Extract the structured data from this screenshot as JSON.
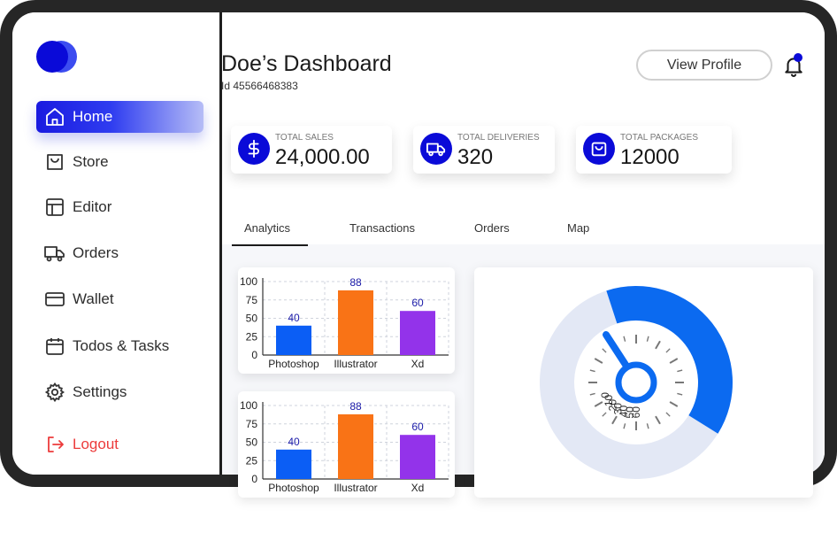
{
  "sidebar": {
    "items": [
      {
        "label": "Home",
        "icon": "home-icon"
      },
      {
        "label": "Store",
        "icon": "store-icon"
      },
      {
        "label": "Editor",
        "icon": "editor-icon"
      },
      {
        "label": "Orders",
        "icon": "truck-icon"
      },
      {
        "label": "Wallet",
        "icon": "wallet-icon"
      },
      {
        "label": "Todos & Tasks",
        "icon": "calendar-icon"
      },
      {
        "label": "Settings",
        "icon": "gear-icon"
      }
    ],
    "logout_label": "Logout"
  },
  "header": {
    "title": "Doe’s Dashboard",
    "id_text": "Id 45566468383",
    "profile_button": "View Profile"
  },
  "stats": [
    {
      "label": "TOTAL SALES",
      "value": "24,000.00",
      "icon": "dollar-icon"
    },
    {
      "label": "TOTAL DELIVERIES",
      "value": "320",
      "icon": "truck-icon"
    },
    {
      "label": "TOTAL PACKAGES",
      "value": "12000",
      "icon": "package-icon"
    }
  ],
  "tabs": [
    "Analytics",
    "Transactions",
    "Orders",
    "Map"
  ],
  "colors": {
    "accent": "#0a0ad8",
    "photoshop": "#0b5ef5",
    "illustrator": "#f97316",
    "xd": "#9333ea",
    "gauge_fill": "#0b6af0",
    "gauge_track": "#e3e8f5",
    "logout": "#ec3b3b"
  },
  "chart_data": [
    {
      "type": "bar",
      "categories": [
        "Photoshop",
        "Illustrator",
        "Xd"
      ],
      "values": [
        40,
        88,
        60
      ],
      "yticks": [
        "100",
        "75",
        "50",
        "25",
        "0"
      ],
      "ylim": [
        0,
        100
      ],
      "grid": true
    },
    {
      "type": "bar",
      "categories": [
        "Photoshop",
        "Illustrator",
        "Xd"
      ],
      "values": [
        40,
        88,
        60
      ],
      "yticks": [
        "100",
        "75",
        "50",
        "25",
        "0"
      ],
      "ylim": [
        0,
        100
      ],
      "grid": true
    }
  ],
  "gauge": {
    "labels": [
      "0",
      "10",
      "20",
      "30",
      "40",
      "50",
      "60"
    ]
  }
}
